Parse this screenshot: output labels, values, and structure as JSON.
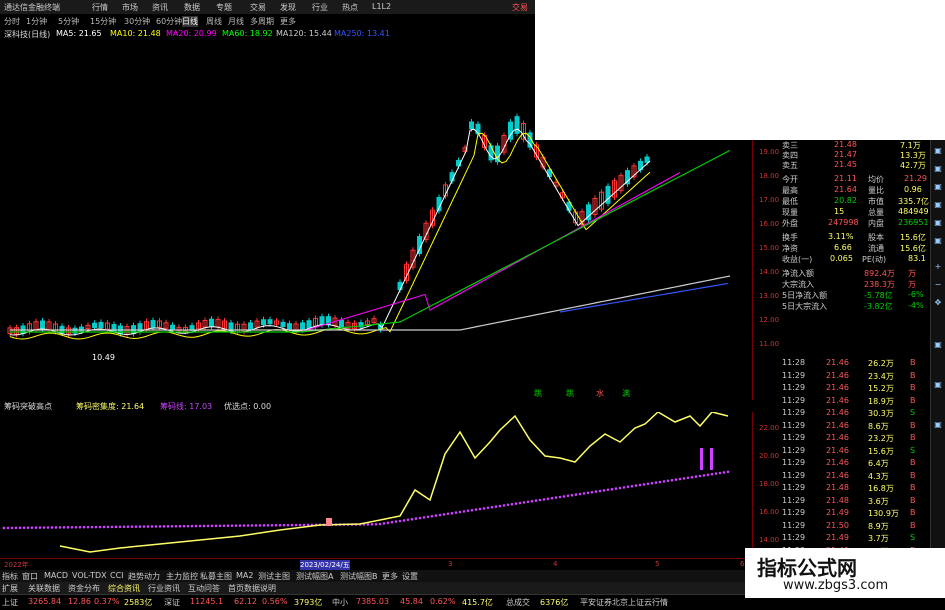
{
  "titlebar": {
    "app_title": "通达信金融终端",
    "menu": [
      "行情",
      "市场",
      "资讯",
      "数据",
      "专题",
      "交易",
      "发现",
      "行业",
      "热点",
      "L1L2"
    ],
    "right": "交易"
  },
  "timeframes": [
    "分时",
    "1分钟",
    "5分钟",
    "15分钟",
    "30分钟",
    "60分钟",
    "日线",
    "周线",
    "月线",
    "多周期",
    "更多"
  ],
  "ma_bar": {
    "stock": "深科技(日线)",
    "ma5": "MA5: 21.65",
    "ma10": "MA10: 21.48",
    "ma20": "MA20: 20.99",
    "ma60": "MA60: 18.92",
    "ma120": "MA120: 15.44",
    "extra": "MA250: 13.41"
  },
  "main_axis": [
    "19.00",
    "18.00",
    "17.00",
    "16.00",
    "15.00",
    "14.00",
    "13.00",
    "12.00",
    "11.00"
  ],
  "main_markers": [
    "跳",
    "跳",
    "水",
    "满"
  ],
  "low_label": "10.49",
  "sub_header": {
    "name": "筹码突破高点",
    "v1": "筹码密集度: 21.64",
    "v2": "筹码线: 17.03",
    "v3": "优选点: 0.00"
  },
  "sub_axis": [
    "22.00",
    "20.00",
    "18.00",
    "16.00",
    "14.00",
    "12.00"
  ],
  "xaxis": {
    "left": "2022年",
    "date": "2023/02/24/五",
    "m3": "3",
    "m4": "4",
    "m5": "5",
    "m6": "6"
  },
  "panel": [
    {
      "k": "卖三",
      "v": "21.48",
      "q": "7.1万"
    },
    {
      "k": "卖四",
      "v": "21.47",
      "q": "13.3万"
    },
    {
      "k": "卖五",
      "v": "21.45",
      "q": "42.7万"
    },
    {
      "k": "今开",
      "v": "21.11",
      "k2": "均价",
      "q": "21.29"
    },
    {
      "k": "最高",
      "v": "21.64",
      "k2": "量比",
      "q": "0.96"
    },
    {
      "k": "最低",
      "v": "20.82",
      "k2": "市值",
      "q": "335.7亿"
    },
    {
      "k": "现量",
      "v": "15",
      "k2": "总量",
      "q": "484949"
    },
    {
      "k": "外盘",
      "v": "247998",
      "k2": "内盘",
      "q": "236951"
    },
    {
      "k": "换手",
      "v": "3.11%",
      "k2": "股本",
      "q": "15.6亿"
    },
    {
      "k": "净资",
      "v": "6.66",
      "k2": "流通",
      "q": "15.6亿"
    },
    {
      "k": "收益(一)",
      "v": "0.065",
      "k2": "PE(动)",
      "q": "83.1"
    },
    {
      "k": "净流入额",
      "v": "892.4万",
      "q": "万"
    },
    {
      "k": "大宗流入",
      "v": "238.3万",
      "q": "万"
    },
    {
      "k": "5日净流入额",
      "v": "-5.78亿",
      "q": "-6%"
    },
    {
      "k": "5日大宗流入",
      "v": "-3.82亿",
      "q": "-4%"
    }
  ],
  "ticks": [
    [
      "11:28",
      "21.46",
      "26.2万",
      "B"
    ],
    [
      "11:29",
      "21.46",
      "23.4万",
      "B"
    ],
    [
      "11:29",
      "21.46",
      "15.2万",
      "B"
    ],
    [
      "11:29",
      "21.46",
      "18.9万",
      "B"
    ],
    [
      "11:29",
      "21.46",
      "30.3万",
      "S"
    ],
    [
      "11:29",
      "21.46",
      "8.6万",
      "B"
    ],
    [
      "11:29",
      "21.46",
      "23.2万",
      "B"
    ],
    [
      "11:29",
      "21.46",
      "15.6万",
      "S"
    ],
    [
      "11:29",
      "21.46",
      "6.4万",
      "B"
    ],
    [
      "11:29",
      "21.46",
      "4.3万",
      "B"
    ],
    [
      "11:29",
      "21.48",
      "16.8万",
      "B"
    ],
    [
      "11:29",
      "21.48",
      "3.6万",
      "B"
    ],
    [
      "11:29",
      "21.49",
      "130.9万",
      "B"
    ],
    [
      "11:29",
      "21.50",
      "8.9万",
      "B"
    ],
    [
      "11:29",
      "21.49",
      "3.7万",
      "S"
    ],
    [
      "11:29",
      "21.49",
      "3.5万",
      "B"
    ]
  ],
  "ind_tabs": [
    "指标",
    "窗口",
    "MACD",
    "VOL-TDX",
    "CCI",
    "趋势动力",
    "主力监控",
    "私募主图",
    "MA2",
    "测试主图",
    "测试幅图A",
    "测试幅图B",
    "更多",
    "设置"
  ],
  "mod_tabs": [
    "扩展",
    "关联数据",
    "资金分布",
    "综合资讯",
    "行业资讯",
    "互动问答",
    "首页数据说明"
  ],
  "status": {
    "sh": "上证",
    "sh_v": "3265.84",
    "sh_c": "12.86",
    "sh_p": "0.37%",
    "sh_a": "2583亿",
    "sz": "深证",
    "sz_v": "11245.1",
    "sz_c": "62.12",
    "sz_p": "0.56%",
    "sz_a": "3793亿",
    "zx": "中小",
    "zx_v": "7385.03",
    "zx_c": "45.84",
    "zx_p": "0.62%",
    "zx_a": "415.7亿",
    "zc": "总成交",
    "zc_v": "6376亿",
    "broker": "平安证券北京上证云行情"
  },
  "watermark": {
    "line1": "指标公式网",
    "line2": "www.zbgs3.com"
  },
  "colors": {
    "up": "#ff3333",
    "down": "#00cccc",
    "ma5": "#ffffff",
    "ma10": "#ffff00",
    "ma20": "#ff00ff",
    "ma60": "#00ff00",
    "ma120": "#cccccc",
    "ma250": "#3355ff",
    "ind": "#ffff66",
    "dots": "#cc44ff"
  }
}
